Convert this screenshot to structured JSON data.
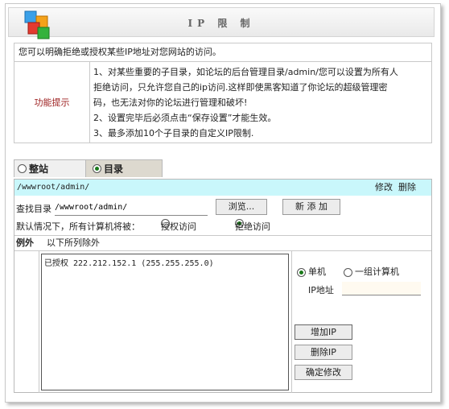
{
  "header": {
    "title": "IP 限 制"
  },
  "description": "您可以明确拒绝或授权某些IP地址对您网站的访问。",
  "hint": {
    "label": "功能提示",
    "lines": [
      "1、对某些重要的子目录，如论坛的后台管理目录/admin/您可以设置为所有人",
      "拒绝访问，只允许您自己的ip访问.这样即使黑客知道了你论坛的超级管理密",
      "码，也无法对你的论坛进行管理和破坏!",
      "2、设置完毕后必须点击“保存设置”才能生效。",
      "3、最多添加10个子目录的自定义IP限制."
    ]
  },
  "tabs": [
    {
      "label": "整站",
      "selected": false
    },
    {
      "label": "目录",
      "selected": true
    }
  ],
  "path_row": {
    "path": "/wwwroot/admin/",
    "modify": "修改",
    "delete": "删除"
  },
  "find": {
    "label": "查找目录",
    "value": "/wwwroot/admin/",
    "browse": "浏览...",
    "add_new": "新 添 加"
  },
  "default_row": {
    "label": "默认情况下，所有计算机将被：",
    "allow": "授权访问",
    "deny": "拒绝访问",
    "selected": "deny"
  },
  "exceptions": {
    "label": "例外",
    "text": "以下所列除外",
    "items": [
      "已授权 222.212.152.1 (255.255.255.0)"
    ]
  },
  "right_panel": {
    "single": "单机",
    "group": "一组计算机",
    "selected": "single",
    "ip_label": "IP地址",
    "ip_value": "",
    "add_ip": "增加IP",
    "remove_ip": "删除IP",
    "confirm": "确定修改"
  },
  "colors": {
    "accent_cyan": "#c9f7fb",
    "hint_label": "#9b1b1b",
    "active_tab": "#ddd9cf"
  }
}
